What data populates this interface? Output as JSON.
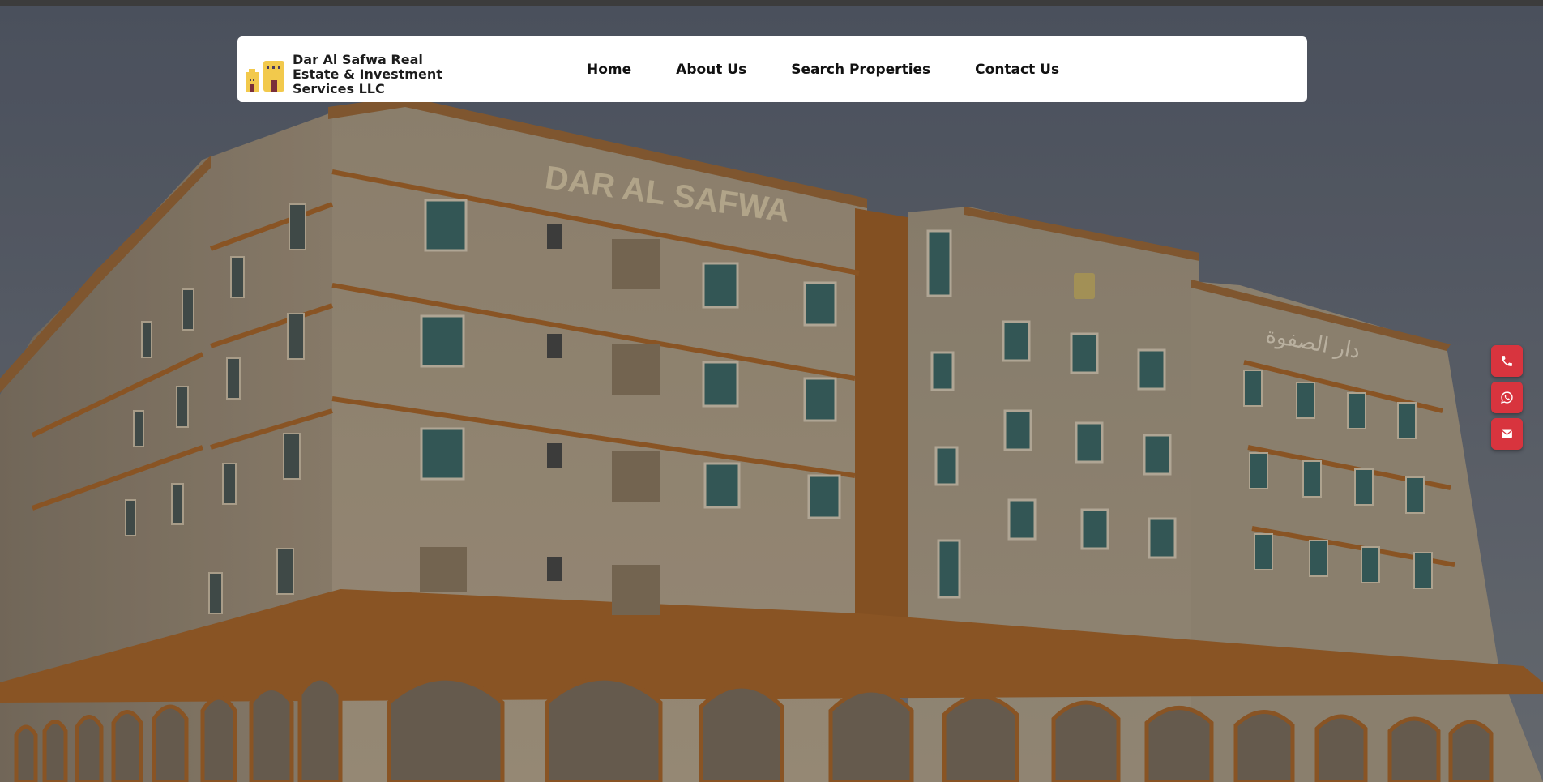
{
  "brand": {
    "name": "Dar Al Safwa Real Estate & Investment Services LLC",
    "logo_icon": "building-logo-icon"
  },
  "nav": {
    "items": [
      {
        "label": "Home"
      },
      {
        "label": "About Us"
      },
      {
        "label": "Search Properties"
      },
      {
        "label": "Contact Us"
      }
    ]
  },
  "hero": {
    "building_sign_en": "DAR AL SAFWA",
    "building_sign_ar": "دار الصفوة"
  },
  "contact_actions": [
    {
      "icon": "phone-icon"
    },
    {
      "icon": "whatsapp-icon"
    },
    {
      "icon": "envelope-icon"
    }
  ],
  "colors": {
    "accent": "#d8343e",
    "navbar_bg": "#ffffff",
    "building": "#c9b59a",
    "trim": "#b8702d"
  }
}
